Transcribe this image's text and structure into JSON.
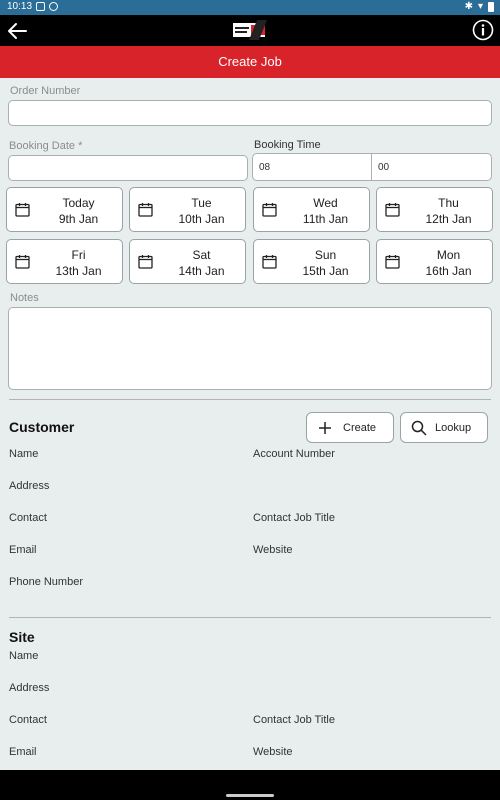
{
  "status": {
    "time": "10:13"
  },
  "header": {
    "title": "Create Job"
  },
  "form": {
    "order_number_label": "Order Number",
    "order_number_value": "",
    "booking_date_label": "Booking Date *",
    "booking_date_value": "",
    "booking_time_label": "Booking Time",
    "booking_hour": "08",
    "booking_minute": "00",
    "notes_label": "Notes",
    "notes_value": ""
  },
  "days": [
    {
      "line1": "Today",
      "line2": "9th Jan"
    },
    {
      "line1": "Tue",
      "line2": "10th Jan"
    },
    {
      "line1": "Wed",
      "line2": "11th Jan"
    },
    {
      "line1": "Thu",
      "line2": "12th Jan"
    },
    {
      "line1": "Fri",
      "line2": "13th Jan"
    },
    {
      "line1": "Sat",
      "line2": "14th Jan"
    },
    {
      "line1": "Sun",
      "line2": "15th Jan"
    },
    {
      "line1": "Mon",
      "line2": "16th Jan"
    }
  ],
  "customer": {
    "title": "Customer",
    "create_label": "Create",
    "lookup_label": "Lookup",
    "name": "Name",
    "account_number": "Account Number",
    "address": "Address",
    "contact": "Contact",
    "contact_job_title": "Contact Job Title",
    "email": "Email",
    "website": "Website",
    "phone_number": "Phone Number"
  },
  "site": {
    "title": "Site",
    "name": "Name",
    "address": "Address",
    "contact": "Contact",
    "contact_job_title": "Contact Job Title",
    "email": "Email",
    "website": "Website"
  },
  "icons": {
    "back": "back-arrow-icon",
    "info": "info-icon",
    "calendar": "calendar-icon",
    "plus": "plus-icon",
    "search": "search-icon"
  },
  "colors": {
    "status_bar": "#2a6d96",
    "header": "#d9232a",
    "background": "#e7eeed"
  }
}
